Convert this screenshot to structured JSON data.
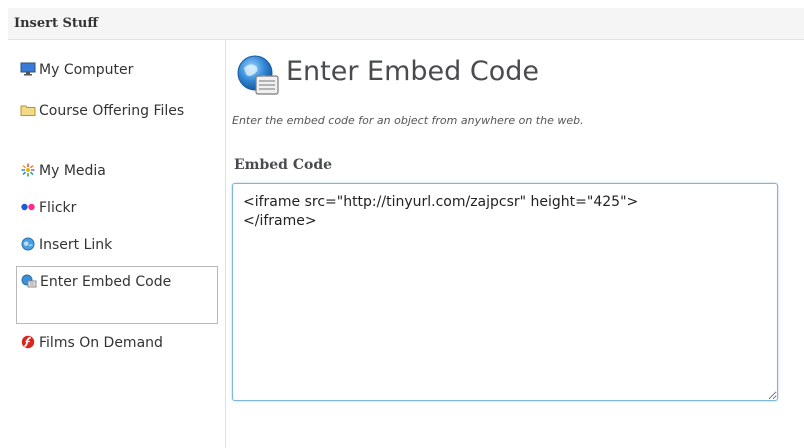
{
  "window": {
    "title": "Insert Stuff"
  },
  "sidebar": {
    "items": [
      {
        "label": "My Computer",
        "icon": "monitor-icon"
      },
      {
        "label": "Course Offering Files",
        "icon": "folder-icon"
      },
      {
        "label": "My Media",
        "icon": "pinwheel-icon"
      },
      {
        "label": "Flickr",
        "icon": "flickr-dots-icon"
      },
      {
        "label": "Insert Link",
        "icon": "globe-link-icon"
      },
      {
        "label": "Enter Embed Code",
        "icon": "globe-code-icon",
        "selected": true
      },
      {
        "label": "Films On Demand",
        "icon": "films-on-demand-icon"
      }
    ]
  },
  "main": {
    "title": "Enter Embed Code",
    "description": "Enter the embed code for an object from anywhere on the web.",
    "field_label": "Embed Code",
    "embed_value": "<iframe src=\"http://tinyurl.com/zajpcsr\" height=\"425\">\n</iframe>"
  },
  "colors": {
    "selected_border": "#b9b9b9",
    "textarea_focus_border": "#7fb6d6",
    "header_background": "#f5f5f5"
  }
}
